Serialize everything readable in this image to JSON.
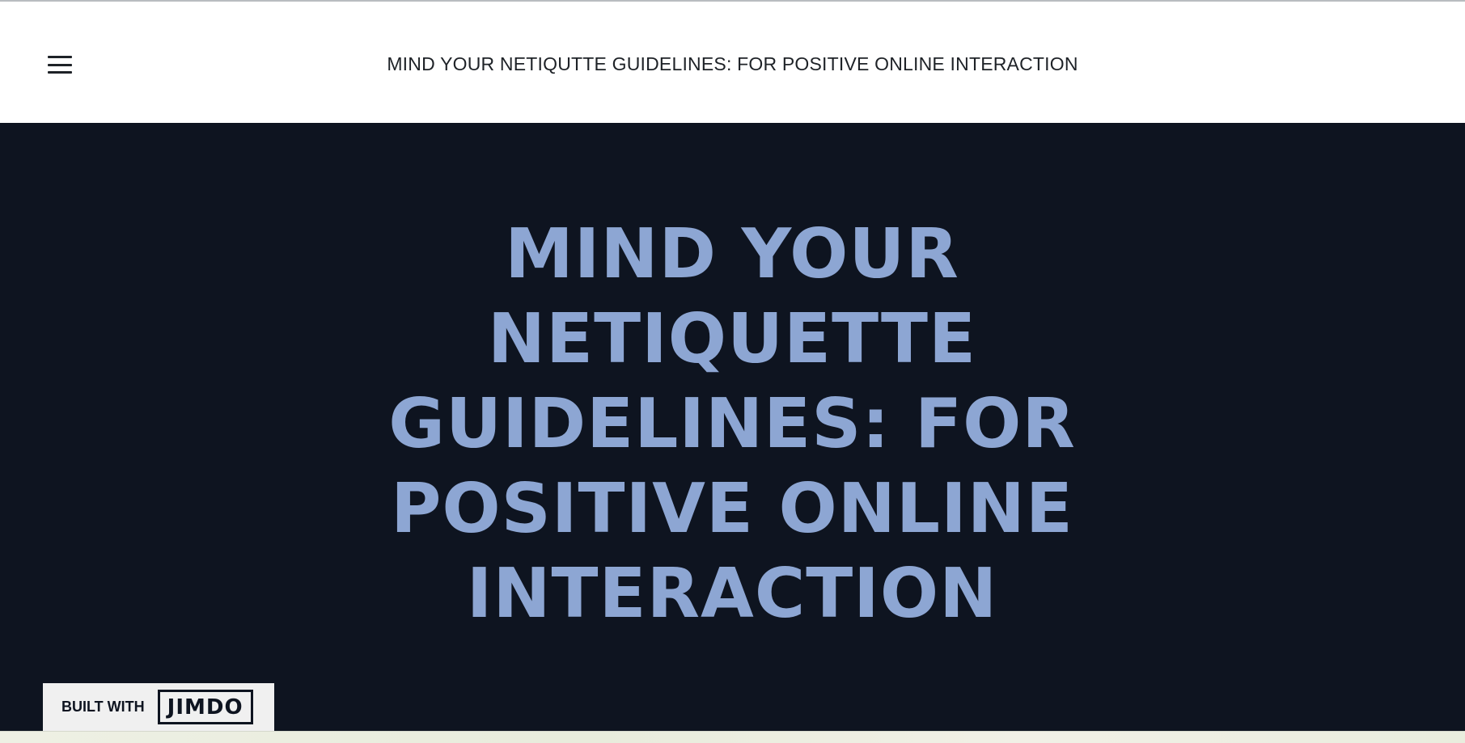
{
  "header": {
    "menu_icon": "hamburger-menu-icon",
    "site_title": "MIND YOUR NETIQUTTE GUIDELINES: FOR POSITIVE ONLINE INTERACTION"
  },
  "hero": {
    "heading": "MIND YOUR NETIQUETTE GUIDELINES: FOR POSITIVE ONLINE INTERACTION"
  },
  "badge": {
    "built_with_label": "BUILT WITH",
    "brand_label": "JIMDO"
  },
  "colors": {
    "hero_background": "#0e1420",
    "hero_text": "#8da6d3",
    "header_background": "#ffffff",
    "header_text": "#1e2227"
  }
}
